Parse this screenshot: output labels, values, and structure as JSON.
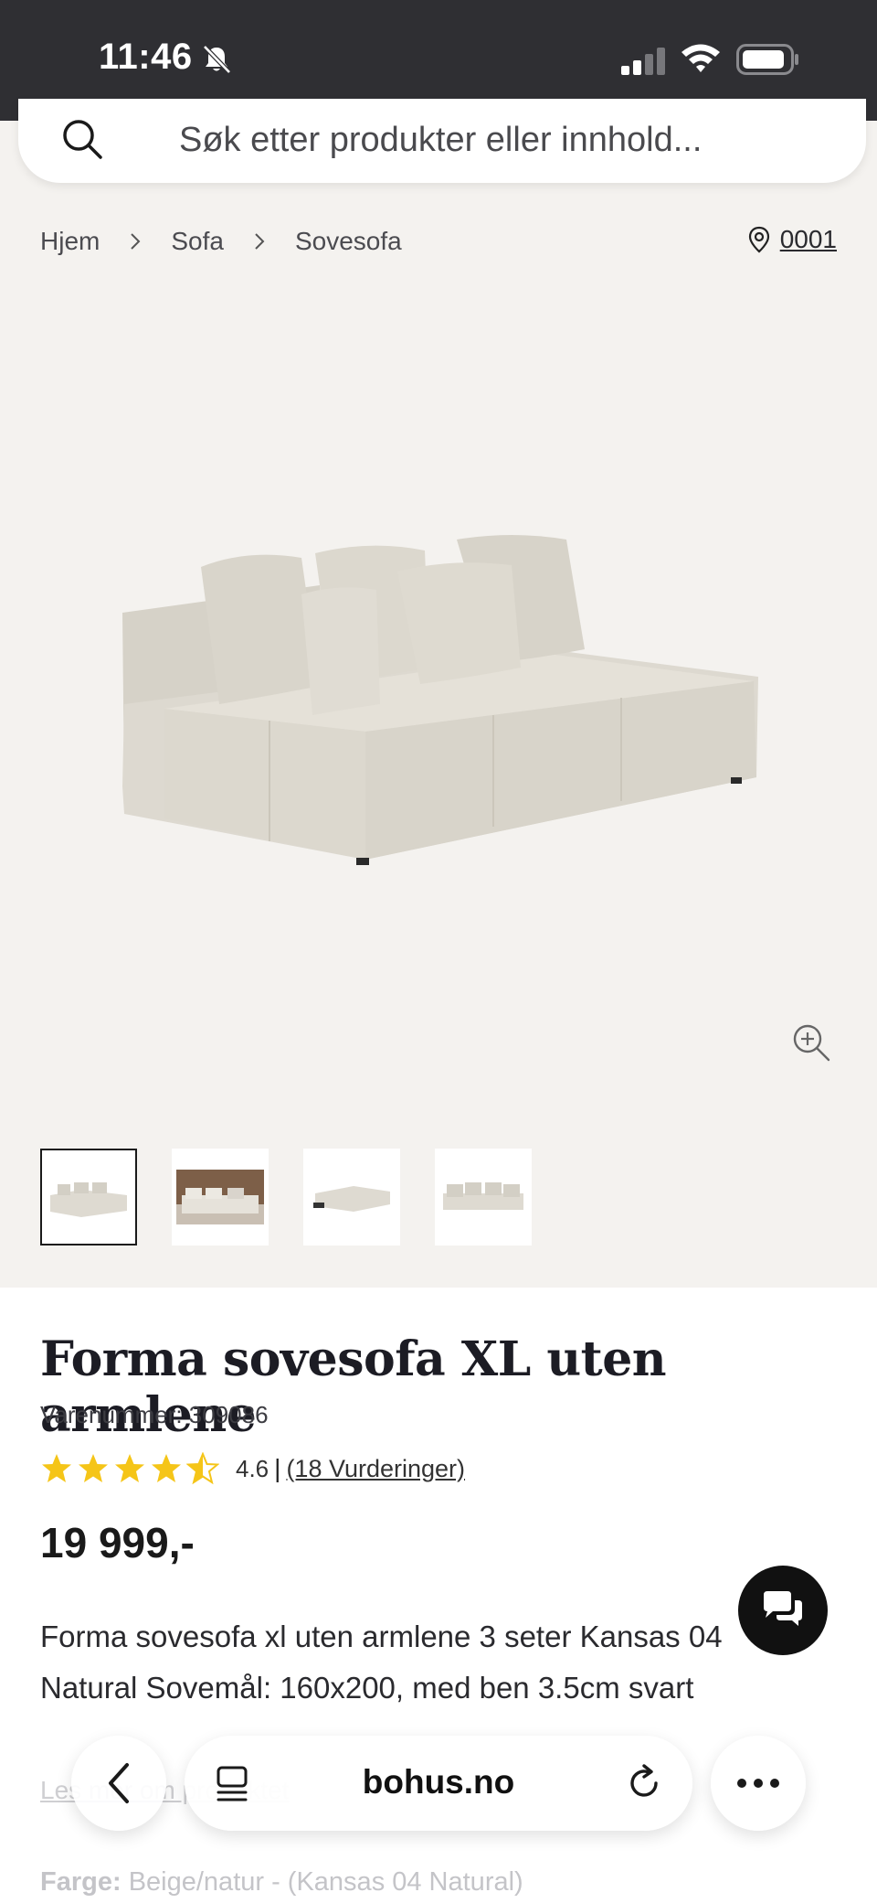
{
  "status": {
    "time": "11:46"
  },
  "search": {
    "placeholder": "Søk etter produkter eller innhold..."
  },
  "breadcrumb": {
    "items": [
      "Hjem",
      "Sofa",
      "Sovesofa"
    ],
    "store": "0001"
  },
  "product": {
    "title": "Forma sovesofa XL uten armlene",
    "sku": "Varenummer: 309086",
    "rating_value": "4.6",
    "rating": 4.6,
    "rating_sep": "|",
    "rating_count": "(18 Vurderinger)",
    "price": "19 999,-",
    "description": "Forma sovesofa xl uten armlene 3 seter Kansas 04 Natural Sovemål: 160x200, med ben 3.5cm svart",
    "read_more": "Les mer om produktet",
    "color_label": "Farge:",
    "color_value": "Beige/natur - (Kansas 04 Natural)"
  },
  "browser": {
    "url": "bohus.no"
  },
  "icons": [
    "bell-off-icon",
    "signal-icon",
    "wifi-icon",
    "battery-icon",
    "search-icon",
    "chevron-right-icon",
    "location-pin-icon",
    "zoom-in-icon",
    "star-icon",
    "chat-icon",
    "back-icon",
    "tabs-icon",
    "reload-icon",
    "more-icon"
  ],
  "colors": {
    "status_bar": "#2f2f33",
    "page_bg": "#f4f2ef",
    "star": "#f5c518",
    "sofa": "#ddd9d0"
  }
}
